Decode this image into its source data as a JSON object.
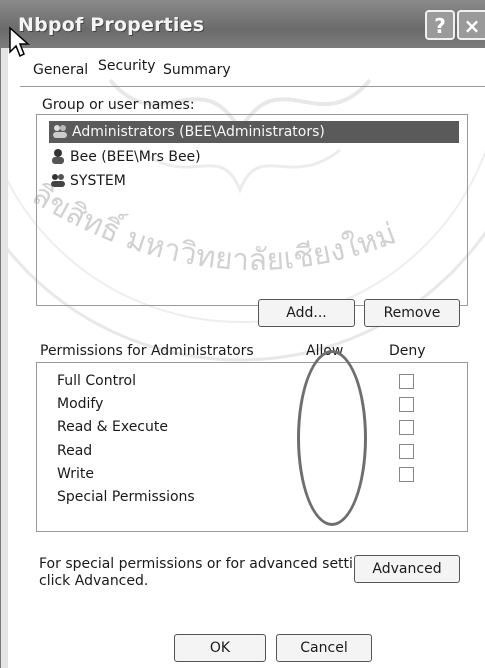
{
  "window": {
    "title": "Nbpof Properties",
    "help_label": "?",
    "close_label": "×"
  },
  "tabs": [
    {
      "label": "General",
      "active": false
    },
    {
      "label": "Security",
      "active": true
    },
    {
      "label": "Summary",
      "active": false
    }
  ],
  "group_section": {
    "label": "Group or user names:",
    "users": [
      {
        "name": "Administrators (BEE\\Administrators)",
        "icon": "user-group-icon",
        "selected": true
      },
      {
        "name": "Bee (BEE\\Mrs Bee)",
        "icon": "user-icon",
        "selected": false
      },
      {
        "name": "SYSTEM",
        "icon": "user-group-icon",
        "selected": false
      }
    ],
    "add_label": "Add...",
    "remove_label": "Remove"
  },
  "permissions": {
    "header": "Permissions for Administrators",
    "allow_label": "Allow",
    "deny_label": "Deny",
    "items": [
      {
        "name": "Full Control",
        "allow": false,
        "deny": false,
        "show_checkbox": true
      },
      {
        "name": "Modify",
        "allow": false,
        "deny": false,
        "show_checkbox": true
      },
      {
        "name": "Read & Execute",
        "allow": false,
        "deny": false,
        "show_checkbox": true
      },
      {
        "name": "Read",
        "allow": false,
        "deny": false,
        "show_checkbox": true
      },
      {
        "name": "Write",
        "allow": false,
        "deny": false,
        "show_checkbox": true
      },
      {
        "name": "Special Permissions",
        "allow": false,
        "deny": false,
        "show_checkbox": false
      }
    ]
  },
  "advanced": {
    "text_line1": "For special permissions or for advanced settings,",
    "text_line2": "click Advanced.",
    "button_label": "Advanced"
  },
  "footer": {
    "ok_label": "OK",
    "cancel_label": "Cancel"
  },
  "watermark": {
    "text": "ลิขสิทธิ์ มหาวิทยาลัยเชียงใหม่"
  }
}
